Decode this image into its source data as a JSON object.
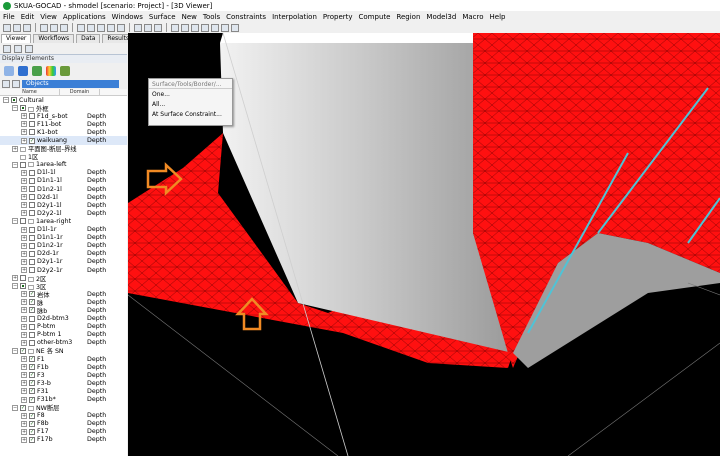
{
  "window": {
    "title": "SKUA-GOCAD - shmodel  [scenario: Project] - [3D Viewer]"
  },
  "menu": [
    "File",
    "Edit",
    "View",
    "Applications",
    "Windows",
    "Surface",
    "New",
    "Tools",
    "Constraints",
    "Interpolation",
    "Property",
    "Compute",
    "Region",
    "Model3d",
    "Macro",
    "Help"
  ],
  "tabs": [
    "Viewer",
    "Workflows",
    "Data",
    "Results",
    "+"
  ],
  "panel": {
    "title": "Display Elements",
    "objects_filter": "Objects",
    "col_name": "Name",
    "col_domain": "Domain"
  },
  "tree": [
    {
      "indent": 0,
      "exp": "⊟",
      "check": "partial",
      "label": "Cultural",
      "domain": ""
    },
    {
      "indent": 1,
      "exp": "⊟",
      "check": "partial",
      "label": "□ 外框",
      "domain": ""
    },
    {
      "indent": 2,
      "exp": "⊞",
      "check": "off",
      "label": "F1d_s-bot",
      "domain": "Depth"
    },
    {
      "indent": 2,
      "exp": "⊞",
      "check": "off",
      "label": "F11-bot",
      "domain": "Depth"
    },
    {
      "indent": 2,
      "exp": "⊞",
      "check": "off",
      "label": "K1-bot",
      "domain": "Depth"
    },
    {
      "indent": 2,
      "exp": "⊞",
      "check": "on",
      "label": "waikuang",
      "domain": "Depth",
      "selected": true
    },
    {
      "indent": 1,
      "exp": "⊞",
      "check": "none",
      "label": "□ 平面图-断层-界线",
      "domain": ""
    },
    {
      "indent": 1,
      "exp": "",
      "check": "none",
      "label": "□ 1区",
      "domain": ""
    },
    {
      "indent": 1,
      "exp": "⊟",
      "check": "off",
      "label": "□ 1area-left",
      "domain": ""
    },
    {
      "indent": 2,
      "exp": "⊞",
      "check": "off",
      "label": "D1l-1l",
      "domain": "Depth"
    },
    {
      "indent": 2,
      "exp": "⊞",
      "check": "off",
      "label": "D1n1-1l",
      "domain": "Depth"
    },
    {
      "indent": 2,
      "exp": "⊞",
      "check": "off",
      "label": "D1n2-1l",
      "domain": "Depth"
    },
    {
      "indent": 2,
      "exp": "⊞",
      "check": "off",
      "label": "D2d-1l",
      "domain": "Depth"
    },
    {
      "indent": 2,
      "exp": "⊞",
      "check": "off",
      "label": "D2y1-1l",
      "domain": "Depth"
    },
    {
      "indent": 2,
      "exp": "⊞",
      "check": "off",
      "label": "D2y2-1l",
      "domain": "Depth"
    },
    {
      "indent": 1,
      "exp": "⊟",
      "check": "off",
      "label": "□ 1area-right",
      "domain": ""
    },
    {
      "indent": 2,
      "exp": "⊞",
      "check": "off",
      "label": "D1l-1r",
      "domain": "Depth"
    },
    {
      "indent": 2,
      "exp": "⊞",
      "check": "off",
      "label": "D1n1-1r",
      "domain": "Depth"
    },
    {
      "indent": 2,
      "exp": "⊞",
      "check": "off",
      "label": "D1n2-1r",
      "domain": "Depth"
    },
    {
      "indent": 2,
      "exp": "⊞",
      "check": "off",
      "label": "D2d-1r",
      "domain": "Depth"
    },
    {
      "indent": 2,
      "exp": "⊞",
      "check": "off",
      "label": "D2y1-1r",
      "domain": "Depth"
    },
    {
      "indent": 2,
      "exp": "⊞",
      "check": "off",
      "label": "D2y2-1r",
      "domain": "Depth"
    },
    {
      "indent": 1,
      "exp": "⊞",
      "check": "off",
      "label": "□ 2区",
      "domain": ""
    },
    {
      "indent": 1,
      "exp": "⊟",
      "check": "partial",
      "label": "□ 3区",
      "domain": ""
    },
    {
      "indent": 2,
      "exp": "⊞",
      "check": "on",
      "label": "岩体",
      "domain": "Depth"
    },
    {
      "indent": 2,
      "exp": "⊞",
      "check": "on",
      "label": "脉",
      "domain": "Depth"
    },
    {
      "indent": 2,
      "exp": "⊞",
      "check": "on",
      "label": "脉b",
      "domain": "Depth"
    },
    {
      "indent": 2,
      "exp": "⊞",
      "check": "off",
      "label": "D2d-btm3",
      "domain": "Depth"
    },
    {
      "indent": 2,
      "exp": "⊞",
      "check": "off",
      "label": "P-btm",
      "domain": "Depth"
    },
    {
      "indent": 2,
      "exp": "⊞",
      "check": "off",
      "label": "P-btm 1",
      "domain": "Depth"
    },
    {
      "indent": 2,
      "exp": "⊞",
      "check": "off",
      "label": "other-btm3",
      "domain": "Depth"
    },
    {
      "indent": 1,
      "exp": "⊟",
      "check": "on",
      "label": "□ NE 各 SN",
      "domain": ""
    },
    {
      "indent": 2,
      "exp": "⊞",
      "check": "on",
      "label": "F1",
      "domain": "Depth"
    },
    {
      "indent": 2,
      "exp": "⊞",
      "check": "on",
      "label": "F1b",
      "domain": "Depth"
    },
    {
      "indent": 2,
      "exp": "⊞",
      "check": "on",
      "label": "F3",
      "domain": "Depth"
    },
    {
      "indent": 2,
      "exp": "⊞",
      "check": "on",
      "label": "F3-b",
      "domain": "Depth"
    },
    {
      "indent": 2,
      "exp": "⊞",
      "check": "on",
      "label": "F31",
      "domain": "Depth"
    },
    {
      "indent": 2,
      "exp": "⊞",
      "check": "on",
      "label": "F31b*",
      "domain": "Depth"
    },
    {
      "indent": 1,
      "exp": "⊟",
      "check": "on",
      "label": "□ NW断层",
      "domain": ""
    },
    {
      "indent": 2,
      "exp": "⊞",
      "check": "on",
      "label": "F8",
      "domain": "Depth"
    },
    {
      "indent": 2,
      "exp": "⊞",
      "check": "on",
      "label": "F8b",
      "domain": "Depth"
    },
    {
      "indent": 2,
      "exp": "⊞",
      "check": "on",
      "label": "F17",
      "domain": "Depth"
    },
    {
      "indent": 2,
      "exp": "⊞",
      "check": "on",
      "label": "F17b",
      "domain": "Depth"
    }
  ],
  "popup": {
    "header": "Surface/Tools/Border/...",
    "items": [
      "One...",
      "All...",
      "At Surface Constraint..."
    ]
  },
  "colors": {
    "surface_red": "#ff1010",
    "mesh": "#6a0000",
    "wall_grey": "#cfcfcf",
    "fault_cyan": "#4fc3d6",
    "arrow": "#f08a24"
  }
}
